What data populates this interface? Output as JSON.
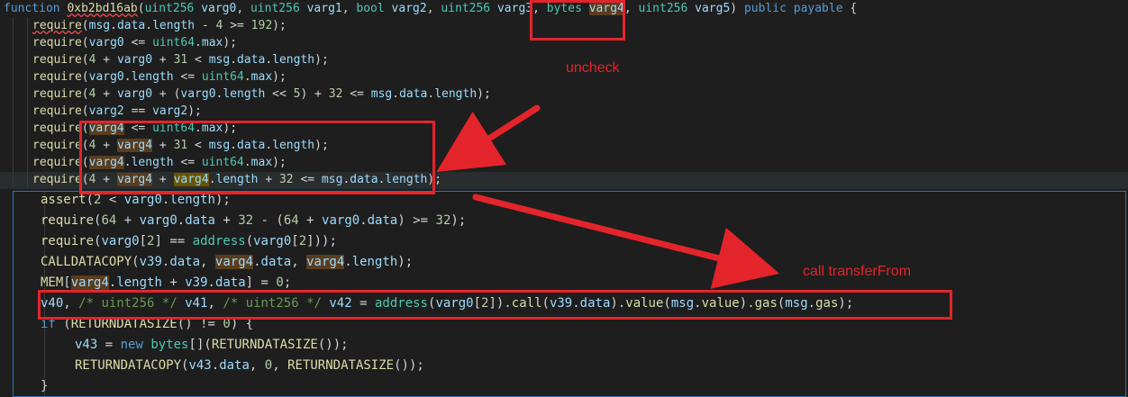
{
  "code_top": {
    "signature": {
      "kw_function": "function",
      "name": "0xb2bd16ab",
      "params": [
        {
          "type": "uint256",
          "name": "varg0"
        },
        {
          "type": "uint256",
          "name": "varg1"
        },
        {
          "type": "bool",
          "name": "varg2"
        },
        {
          "type": "uint256",
          "name": "varg3"
        },
        {
          "type": "bytes",
          "name": "varg4"
        },
        {
          "type": "uint256",
          "name": "varg5"
        }
      ],
      "modifiers": "public payable",
      "open_brace": "{"
    },
    "lines": [
      "require(msg.data.length - 4 >= 192);",
      "require(varg0 <= uint64.max);",
      "require(4 + varg0 + 31 < msg.data.length);",
      "require(varg0.length <= uint64.max);",
      "require(4 + varg0 + (varg0.length << 5) + 32 <= msg.data.length);",
      "require(varg2 == varg2);",
      "require(varg4 <= uint64.max);",
      "require(4 + varg4 + 31 < msg.data.length);",
      "require(varg4.length <= uint64.max);",
      "require(4 + varg4 + varg4.length + 32 <= msg.data.length);"
    ]
  },
  "code_panel": {
    "lines": [
      "assert(2 < varg0.length);",
      "require(64 + varg0.data + 32 - (64 + varg0.data) >= 32);",
      "require(varg0[2] == address(varg0[2]));",
      "CALLDATACOPY(v39.data, varg4.data, varg4.length);",
      "MEM[varg4.length + v39.data] = 0;",
      "v40, /* uint256 */ v41, /* uint256 */ v42 = address(varg0[2]).call(v39.data).value(msg.value).gas(msg.gas);",
      "if (RETURNDATASIZE() != 0) {",
      "v43 = new bytes[](RETURNDATASIZE());",
      "RETURNDATACOPY(v43.data, 0, RETURNDATASIZE());",
      "}"
    ]
  },
  "annotations": {
    "uncheck": "uncheck",
    "call_transfer": "call transferFrom"
  },
  "colors": {
    "annotation_red": "#e3242b",
    "keyword_blue": "#569cd6",
    "type_teal": "#4ec9b0",
    "function_yellow": "#dcdcaa",
    "variable_lightblue": "#9cdcfe",
    "number_green": "#b5cea8",
    "comment_green": "#6a9955"
  }
}
